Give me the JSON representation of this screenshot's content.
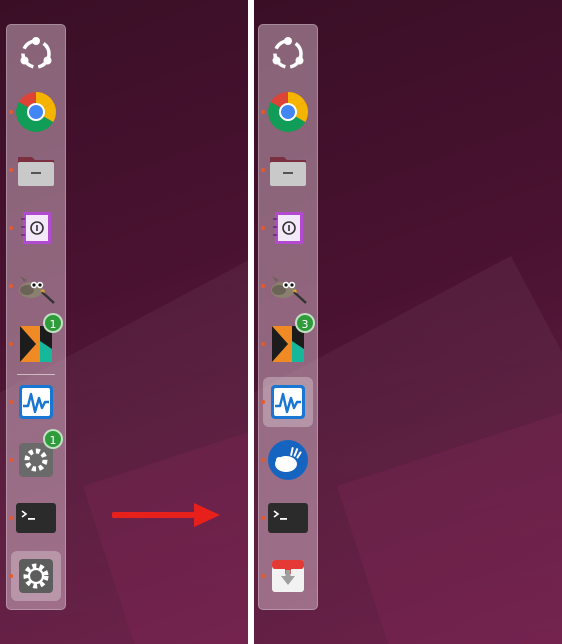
{
  "colors": {
    "badge": "#2f9b3a",
    "running_indicator": "#e45a2a",
    "arrow": "#e8201c",
    "dock_background": "rgba(230,205,220,0.45)"
  },
  "dock_before": {
    "items": [
      {
        "icon": "ubuntu-logo-icon",
        "running": false
      },
      {
        "icon": "chrome-icon",
        "running": true
      },
      {
        "icon": "files-folder-icon",
        "running": true
      },
      {
        "icon": "info-notebook-icon",
        "running": true
      },
      {
        "icon": "gimp-icon",
        "running": true
      },
      {
        "icon": "kolourpaint-icon",
        "running": true,
        "badge": "1"
      },
      {
        "icon": "system-monitor-icon",
        "running": true
      },
      {
        "icon": "software-updater-icon",
        "running": true,
        "badge": "1"
      },
      {
        "icon": "terminal-icon",
        "running": true
      },
      {
        "icon": "settings-icon",
        "running": true,
        "selected": true
      }
    ]
  },
  "dock_after": {
    "items": [
      {
        "icon": "ubuntu-logo-icon",
        "running": false
      },
      {
        "icon": "chrome-icon",
        "running": true
      },
      {
        "icon": "files-folder-icon",
        "running": true
      },
      {
        "icon": "info-notebook-icon",
        "running": true
      },
      {
        "icon": "gimp-icon",
        "running": true
      },
      {
        "icon": "kolourpaint-icon",
        "running": true,
        "badge": "3"
      },
      {
        "icon": "system-monitor-icon",
        "running": true,
        "selected": true
      },
      {
        "icon": "xfce-mouse-icon",
        "running": true
      },
      {
        "icon": "terminal-icon",
        "running": true
      },
      {
        "icon": "package-install-icon",
        "running": true
      }
    ]
  }
}
